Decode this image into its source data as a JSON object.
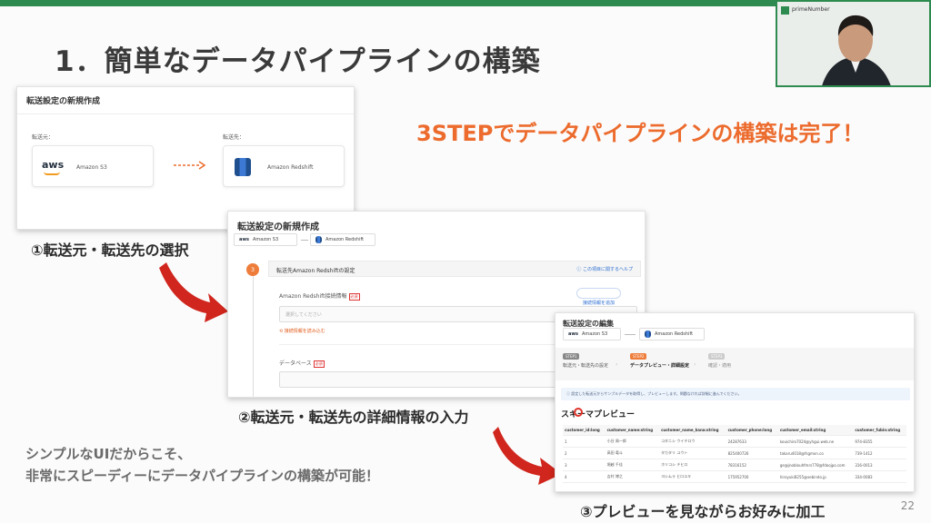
{
  "slide": {
    "title": "1．簡単なデータパイプラインの構築",
    "headline": "3STEPでデータパイプラインの構築は完了！",
    "step1_caption": "①転送元・転送先の選択",
    "step2_caption": "②転送元・転送先の詳細情報の入力",
    "step3_caption": "③プレビューを見ながらお好みに加工",
    "summary_line1": "シンプルなUIだからこそ、",
    "summary_line2": "非常にスピーディーにデータパイプラインの構築が可能！",
    "page_number": "22"
  },
  "webcam": {
    "brand": "primeNumber"
  },
  "shot1": {
    "title": "転送設定の新規作成",
    "source_label": "転送元：",
    "dest_label": "転送先：",
    "aws_logo": "aws",
    "source_name": "Amazon S3",
    "dest_name": "Amazon Redshift"
  },
  "shot2": {
    "title": "転送設定の新規作成",
    "source_pill": "Amazon S3",
    "dest_pill": "Amazon Redshift",
    "aws_logo": "aws",
    "step_number": "3",
    "section_title": "転送先Amazon Redshiftの設定",
    "help_link": "この項目に関するヘルプ",
    "conn_label": "Amazon Redshift接続情報",
    "required_tag": "必須",
    "add_conn_button": "接続情報を追加",
    "select_placeholder": "選択してください",
    "reload_link": "接続情報を読み込む",
    "database_label": "データベース"
  },
  "shot3": {
    "title": "転送設定の編集",
    "source_pill": "Amazon S3",
    "dest_pill": "Amazon Redshift",
    "aws_logo": "aws",
    "steps": [
      {
        "chip": "STEP1",
        "label": "転送元・転送先の設定"
      },
      {
        "chip": "STEP2",
        "label": "データプレビュー・詳細設定"
      },
      {
        "chip": "STEP3",
        "label": "確認・適用"
      }
    ],
    "info_text": "設定した転送元からサンプルデータを取得し、プレビューします。問題なければ詳細に進んでください。",
    "preview_heading": "スキーマプレビュー",
    "columns": [
      "customer_id:long",
      "customer_name:string",
      "customer_name_kana:string",
      "customer_phone:long",
      "customer_email:string",
      "customer_fubin:string"
    ],
    "rows": [
      [
        "1",
        "小谷 周一郎",
        "コタニシ ウイチロウ",
        "24287633",
        "kouichiro7024@yhgui.web.ne",
        "974-8355"
      ],
      [
        "2",
        "高田 竜斗",
        "タカタリ ユウト",
        "825400726",
        "takaru4018@fsgmon.co",
        "739-1412"
      ],
      [
        "3",
        "堀越 千佳",
        "ホリコシ チヒロ",
        "78316152",
        "ge@jnoblouhfmrs778@fdoojpo.com",
        "316-0013"
      ],
      [
        "4",
        "吉村 博之",
        "ヨシムラ ヒロユキ",
        "175952700",
        "hiroyuki8255@xebindo.jp",
        "334-0083"
      ]
    ]
  },
  "colors": {
    "accent": "#ec6b2d",
    "brand_green": "#2e8b4f",
    "arrow_red": "#d0261d"
  }
}
